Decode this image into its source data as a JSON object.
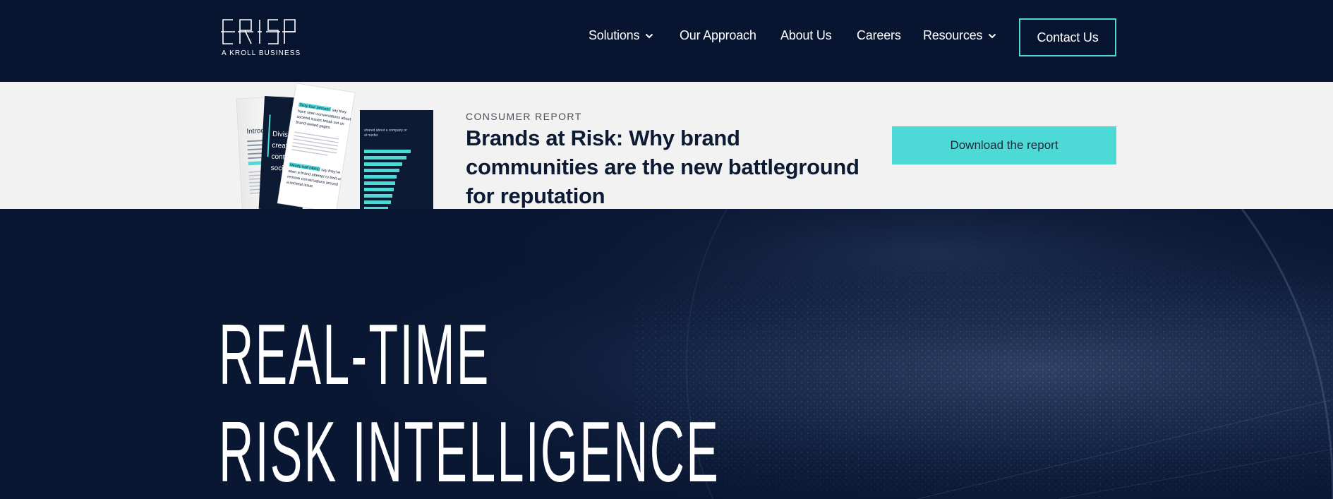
{
  "header": {
    "logo_text": "CRISP",
    "logo_subtitle": "A KROLL BUSINESS",
    "nav": [
      {
        "label": "Solutions",
        "has_dropdown": true
      },
      {
        "label": "Our Approach",
        "has_dropdown": false
      },
      {
        "label": "About Us",
        "has_dropdown": false
      },
      {
        "label": "Careers",
        "has_dropdown": false
      },
      {
        "label": "Resources",
        "has_dropdown": true
      }
    ],
    "contact_label": "Contact Us"
  },
  "banner": {
    "eyebrow": "CONSUMER REPORT",
    "title": "Brands at Risk: Why brand communities are the new battleground for reputation",
    "cta_label": "Download the report",
    "report_snippets": {
      "left_page_heading": "Introd",
      "middle_page_text": "Divisi create conte socia",
      "highlight_1": "Sixty-four percent",
      "highlight_2": "Nearly half (46%)"
    }
  },
  "hero": {
    "line1": "REAL-TIME",
    "line2": "RISK INTELLIGENCE"
  },
  "colors": {
    "navy": "#081530",
    "teal": "#4dd9d6",
    "banner_bg": "#f2f2f2",
    "white": "#ffffff"
  }
}
